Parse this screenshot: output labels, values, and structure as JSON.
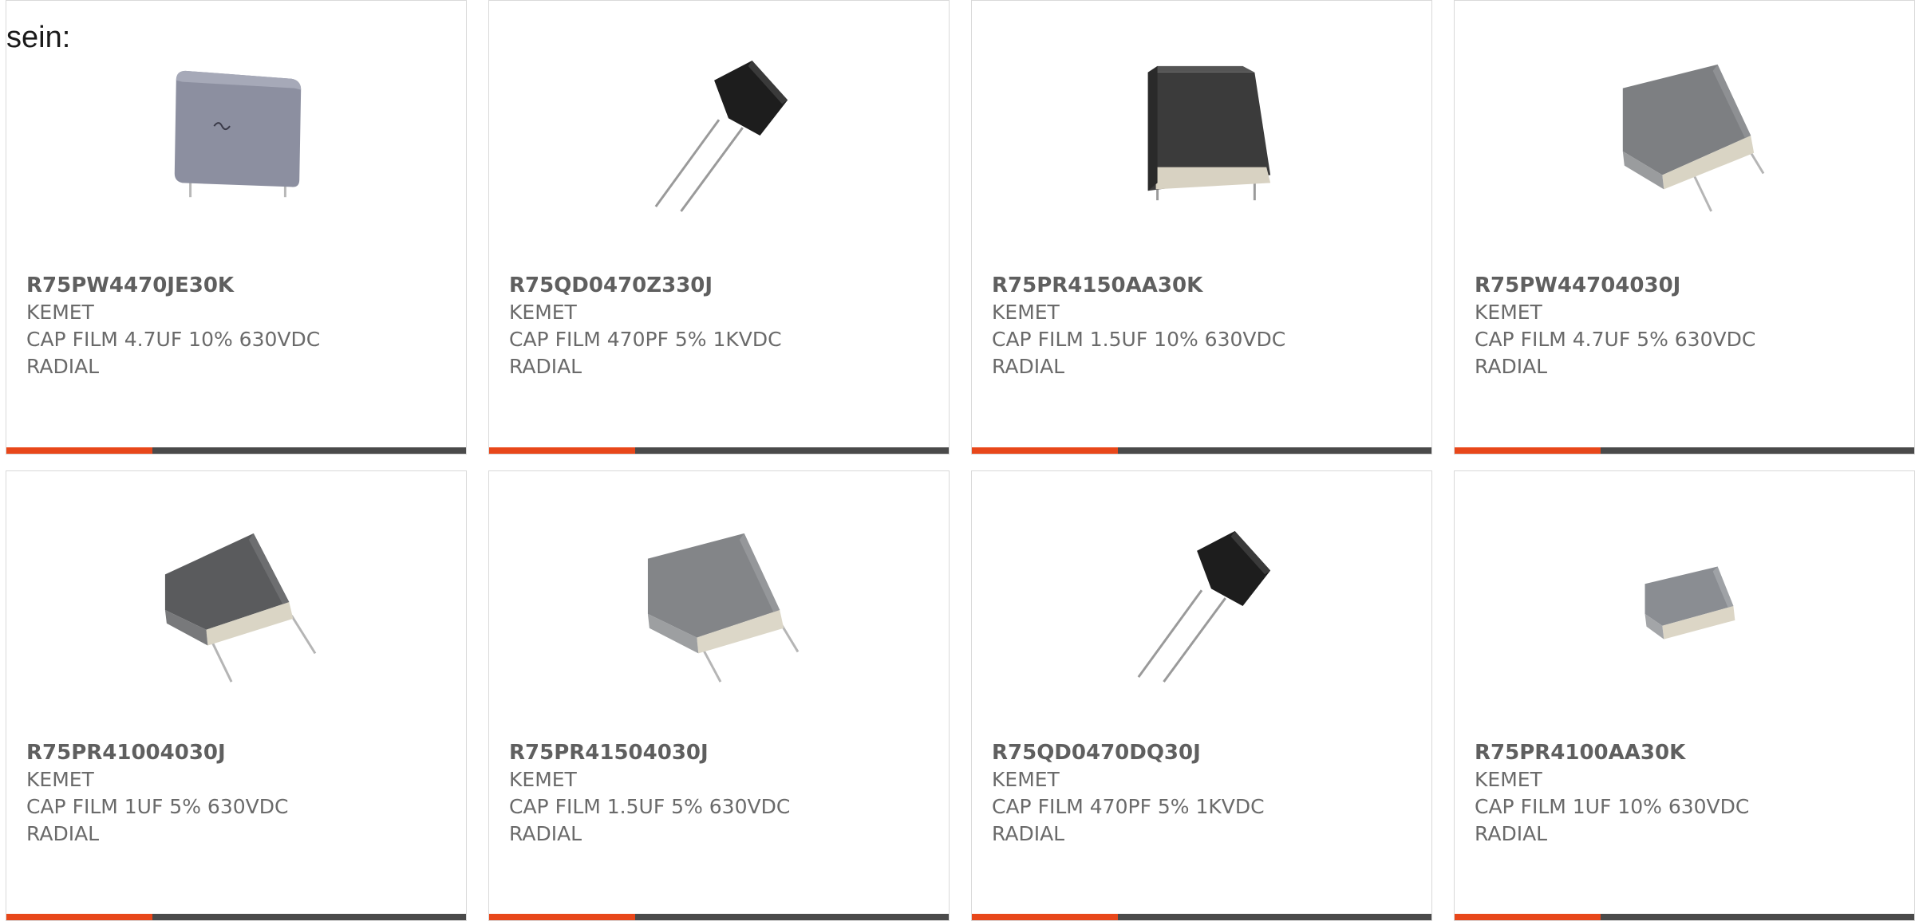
{
  "intro_text": "sein:",
  "colors": {
    "accent": "#e8471a",
    "bar": "#4a4a4a",
    "border": "#d9d9d9"
  },
  "products": [
    {
      "part_number": "R75PW4470JE30K",
      "manufacturer": "KEMET",
      "description_line1": "CAP FILM 4.7UF 10% 630VDC",
      "description_line2": "RADIAL",
      "image": "film-capacitor-gray-box-icon"
    },
    {
      "part_number": "R75QD0470Z330J",
      "manufacturer": "KEMET",
      "description_line1": "CAP FILM 470PF 5% 1KVDC",
      "description_line2": "RADIAL",
      "image": "film-capacitor-black-small-icon"
    },
    {
      "part_number": "R75PR4150AA30K",
      "manufacturer": "KEMET",
      "description_line1": "CAP FILM 1.5UF 10% 630VDC",
      "description_line2": "RADIAL",
      "image": "film-capacitor-dark-box-icon"
    },
    {
      "part_number": "R75PW44704030J",
      "manufacturer": "KEMET",
      "description_line1": "CAP FILM 4.7UF 5% 630VDC",
      "description_line2": "RADIAL",
      "image": "film-capacitor-gray-tilted-icon"
    },
    {
      "part_number": "R75PR41004030J",
      "manufacturer": "KEMET",
      "description_line1": "CAP FILM 1UF 5% 630VDC",
      "description_line2": "RADIAL",
      "image": "film-capacitor-dark-tilted-icon"
    },
    {
      "part_number": "R75PR41504030J",
      "manufacturer": "KEMET",
      "description_line1": "CAP FILM 1.5UF 5% 630VDC",
      "description_line2": "RADIAL",
      "image": "film-capacitor-gray-tilted-icon"
    },
    {
      "part_number": "R75QD0470DQ30J",
      "manufacturer": "KEMET",
      "description_line1": "CAP FILM 470PF 5% 1KVDC",
      "description_line2": "RADIAL",
      "image": "film-capacitor-black-small-icon"
    },
    {
      "part_number": "R75PR4100AA30K",
      "manufacturer": "KEMET",
      "description_line1": "CAP FILM 1UF 10% 630VDC",
      "description_line2": "RADIAL",
      "image": "film-capacitor-small-gray-icon"
    }
  ]
}
